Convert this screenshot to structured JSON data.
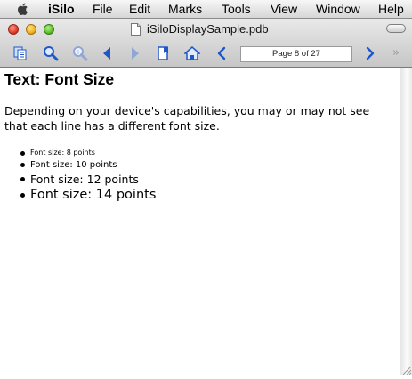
{
  "menubar": {
    "apple_icon": "apple-logo-icon",
    "app_name": "iSilo",
    "items": [
      "File",
      "Edit",
      "Marks",
      "Tools",
      "View",
      "Window",
      "Help"
    ]
  },
  "window": {
    "title": "iSiloDisplaySample.pdb",
    "document_icon": "document-icon"
  },
  "toolbar": {
    "icons": [
      "copy-icon",
      "find-icon",
      "find-next-icon",
      "back-triangle-icon",
      "forward-triangle-icon",
      "bookmark-icon",
      "home-icon",
      "previous-page-icon",
      "next-page-icon",
      "toolbar-overflow-icon"
    ],
    "page_indicator": "Page 8 of 27",
    "overflow_glyph": "»",
    "active_color": "#1f57c8",
    "disabled_color": "#8fa6d6"
  },
  "document": {
    "heading": "Text: Font Size",
    "paragraph": "Depending on your device's capabilities, you may or may not see that each line has a different font size.",
    "list": [
      "Font size: 8 points",
      "Font size: 10 points",
      "Font size: 12 points",
      "Font size: 14 points"
    ]
  }
}
